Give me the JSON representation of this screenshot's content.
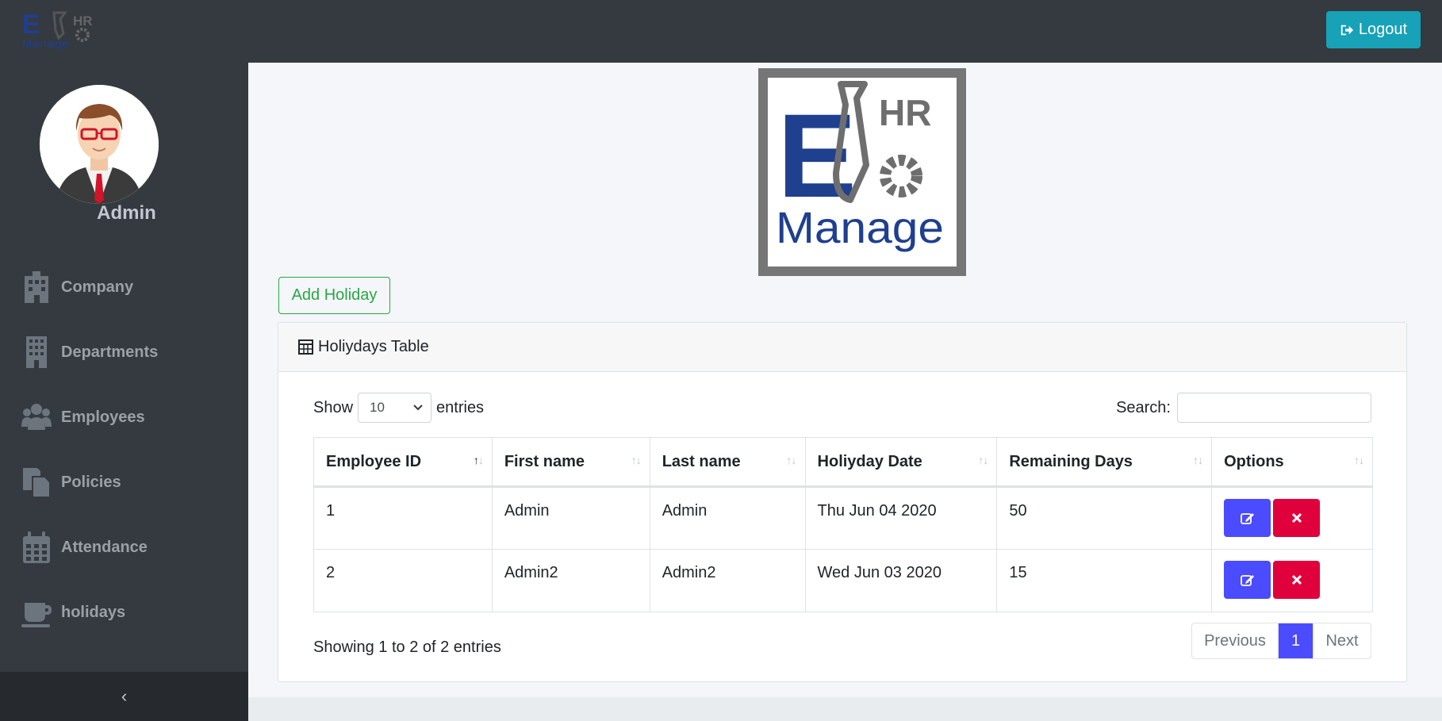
{
  "topbar": {
    "logout_label": "Logout"
  },
  "logo": {
    "letter": "E",
    "hr": "HR",
    "manage": "Manage"
  },
  "sidebar": {
    "user_name": "Admin",
    "items": [
      {
        "label": "Company",
        "icon": "building-icon"
      },
      {
        "label": "Departments",
        "icon": "office-building-icon"
      },
      {
        "label": "Employees",
        "icon": "users-icon"
      },
      {
        "label": "Policies",
        "icon": "copy-icon"
      },
      {
        "label": "Attendance",
        "icon": "calendar-icon"
      },
      {
        "label": "holidays",
        "icon": "coffee-icon"
      }
    ],
    "collapse_glyph": "‹"
  },
  "main": {
    "add_button": "Add Holiday",
    "card_title": "Holiydays Table",
    "show_label": "Show",
    "entries_value": "10",
    "entries_label": "entries",
    "search_label": "Search:",
    "columns": [
      "Employee ID",
      "First name",
      "Last name",
      "Holiyday Date",
      "Remaining Days",
      "Options"
    ],
    "rows": [
      [
        "1",
        "Admin",
        "Admin",
        "Thu Jun 04 2020",
        "50"
      ],
      [
        "2",
        "Admin2",
        "Admin2",
        "Wed Jun 03 2020",
        "15"
      ]
    ],
    "info": "Showing 1 to 2 of 2 entries",
    "pagination": {
      "previous": "Previous",
      "current": "1",
      "next": "Next"
    }
  },
  "colors": {
    "sidebar": "#343a40",
    "logout": "#17a2b8",
    "add": "#28a745",
    "edit": "#4b4bff",
    "delete": "#e0003c",
    "logo_blue": "#1f3f8f",
    "logo_grey": "#767676"
  }
}
